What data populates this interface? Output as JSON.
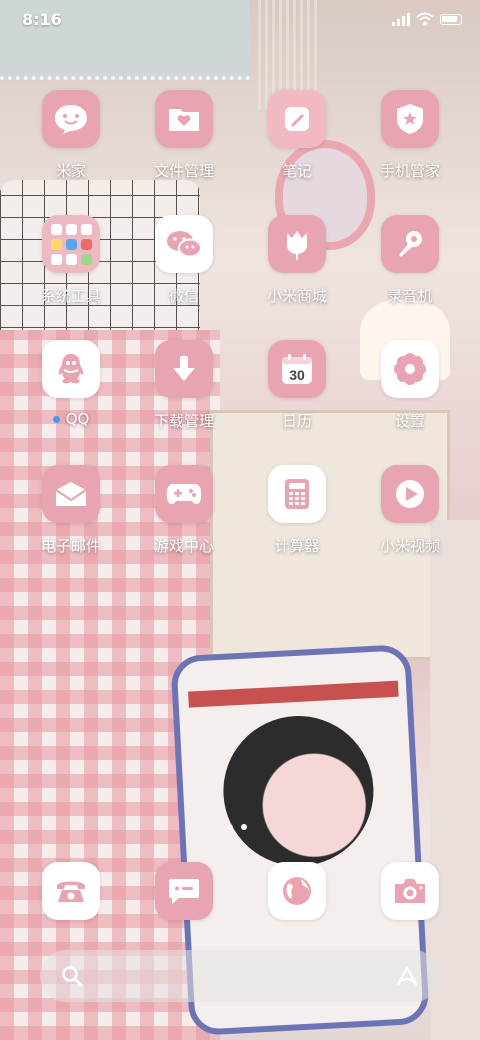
{
  "status_bar": {
    "time": "8:16"
  },
  "apps": [
    {
      "label": "米家",
      "icon": "smile-icon",
      "style": "pink"
    },
    {
      "label": "文件管理",
      "icon": "folder-heart-icon",
      "style": "pink"
    },
    {
      "label": "笔记",
      "icon": "note-pen-icon",
      "style": "white"
    },
    {
      "label": "手机管家",
      "icon": "shield-star-icon",
      "style": "pink"
    },
    {
      "label": "系统工具",
      "icon": "folder-grid-icon",
      "style": "pink"
    },
    {
      "label": "微信",
      "icon": "chat-bubbles-icon",
      "style": "white"
    },
    {
      "label": "小米商城",
      "icon": "tulip-icon",
      "style": "pink"
    },
    {
      "label": "录音机",
      "icon": "microphone-icon",
      "style": "pink"
    },
    {
      "label": "QQ",
      "icon": "penguin-icon",
      "style": "white"
    },
    {
      "label": "下载管理",
      "icon": "download-arrow-icon",
      "style": "pink"
    },
    {
      "label": "日历",
      "icon": "calendar-icon",
      "style": "pink",
      "value": "30"
    },
    {
      "label": "设置",
      "icon": "gear-flower-icon",
      "style": "white"
    },
    {
      "label": "电子邮件",
      "icon": "envelope-icon",
      "style": "pink"
    },
    {
      "label": "游戏中心",
      "icon": "gamepad-icon",
      "style": "pink"
    },
    {
      "label": "计算器",
      "icon": "calculator-icon",
      "style": "white"
    },
    {
      "label": "小米视频",
      "icon": "play-icon",
      "style": "pink"
    }
  ],
  "dock": [
    {
      "icon": "phone-icon"
    },
    {
      "icon": "message-icon"
    },
    {
      "icon": "globe-icon"
    },
    {
      "icon": "camera-icon"
    }
  ],
  "page_indicator": {
    "pages": 2,
    "active": 2
  },
  "colors": {
    "accent_pink": "#e8a4b0",
    "label_text": "#ffffff",
    "qq_dot": "#3d9bf0"
  }
}
